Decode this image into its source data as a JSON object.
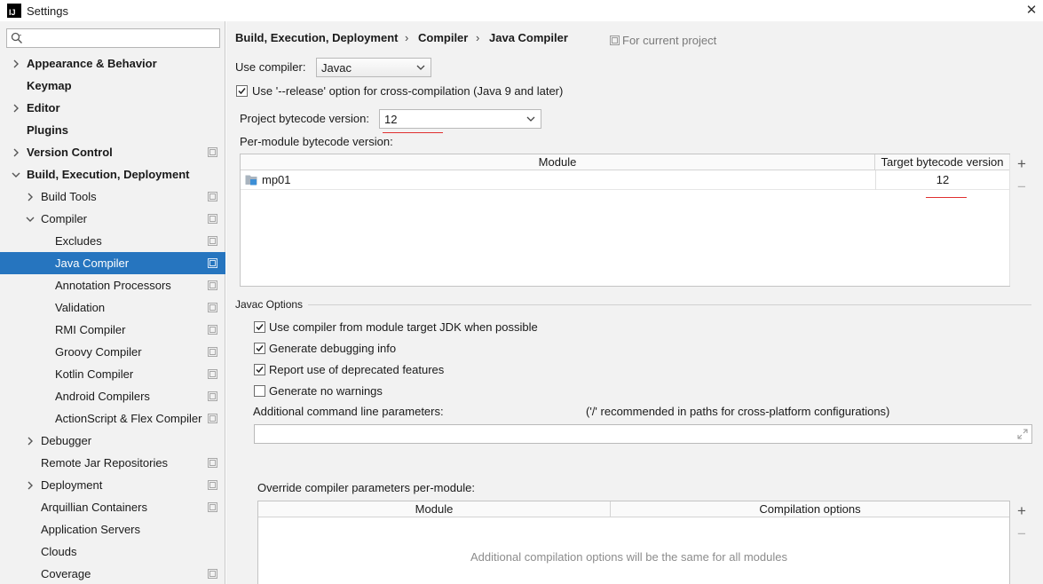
{
  "window": {
    "title": "Settings",
    "app_icon_text": "IJ"
  },
  "sidebar": {
    "search_placeholder": "",
    "items": [
      {
        "label": "Appearance & Behavior",
        "bold": true,
        "arrow": "right",
        "level": 0,
        "project": false
      },
      {
        "label": "Keymap",
        "bold": true,
        "arrow": "",
        "level": 0,
        "project": false
      },
      {
        "label": "Editor",
        "bold": true,
        "arrow": "right",
        "level": 0,
        "project": false
      },
      {
        "label": "Plugins",
        "bold": true,
        "arrow": "",
        "level": 0,
        "project": false
      },
      {
        "label": "Version Control",
        "bold": true,
        "arrow": "right",
        "level": 0,
        "project": true
      },
      {
        "label": "Build, Execution, Deployment",
        "bold": true,
        "arrow": "down",
        "level": 0,
        "project": false
      },
      {
        "label": "Build Tools",
        "bold": false,
        "arrow": "right",
        "level": 1,
        "project": true
      },
      {
        "label": "Compiler",
        "bold": false,
        "arrow": "down",
        "level": 1,
        "project": true
      },
      {
        "label": "Excludes",
        "bold": false,
        "arrow": "",
        "level": 2,
        "project": true
      },
      {
        "label": "Java Compiler",
        "bold": false,
        "arrow": "",
        "level": 2,
        "project": true,
        "selected": true
      },
      {
        "label": "Annotation Processors",
        "bold": false,
        "arrow": "",
        "level": 2,
        "project": true
      },
      {
        "label": "Validation",
        "bold": false,
        "arrow": "",
        "level": 2,
        "project": true
      },
      {
        "label": "RMI Compiler",
        "bold": false,
        "arrow": "",
        "level": 2,
        "project": true
      },
      {
        "label": "Groovy Compiler",
        "bold": false,
        "arrow": "",
        "level": 2,
        "project": true
      },
      {
        "label": "Kotlin Compiler",
        "bold": false,
        "arrow": "",
        "level": 2,
        "project": true
      },
      {
        "label": "Android Compilers",
        "bold": false,
        "arrow": "",
        "level": 2,
        "project": true
      },
      {
        "label": "ActionScript & Flex Compiler",
        "bold": false,
        "arrow": "",
        "level": 2,
        "project": true
      },
      {
        "label": "Debugger",
        "bold": false,
        "arrow": "right",
        "level": 1,
        "project": false
      },
      {
        "label": "Remote Jar Repositories",
        "bold": false,
        "arrow": "",
        "level": 1,
        "project": true
      },
      {
        "label": "Deployment",
        "bold": false,
        "arrow": "right",
        "level": 1,
        "project": true
      },
      {
        "label": "Arquillian Containers",
        "bold": false,
        "arrow": "",
        "level": 1,
        "project": true
      },
      {
        "label": "Application Servers",
        "bold": false,
        "arrow": "",
        "level": 1,
        "project": false
      },
      {
        "label": "Clouds",
        "bold": false,
        "arrow": "",
        "level": 1,
        "project": false
      },
      {
        "label": "Coverage",
        "bold": false,
        "arrow": "",
        "level": 1,
        "project": true
      }
    ]
  },
  "breadcrumb": {
    "parts": [
      "Build, Execution, Deployment",
      "Compiler",
      "Java Compiler"
    ],
    "separator": "›",
    "scope_note": "For current project"
  },
  "compiler": {
    "use_compiler_label": "Use compiler:",
    "use_compiler_value": "Javac",
    "release_option_label": "Use '--release' option for cross-compilation (Java 9 and later)",
    "release_option_checked": true,
    "project_bytecode_label": "Project bytecode version:",
    "project_bytecode_value": "12",
    "per_module_label": "Per-module bytecode version:",
    "module_table": {
      "headers": [
        "Module",
        "Target bytecode version"
      ],
      "rows": [
        {
          "module": "mp01",
          "target": "12"
        }
      ]
    }
  },
  "javac_options": {
    "title": "Javac Options",
    "checkboxes": [
      {
        "label": "Use compiler from module target JDK when possible",
        "checked": true
      },
      {
        "label": "Generate debugging info",
        "checked": true
      },
      {
        "label": "Report use of deprecated features",
        "checked": true
      },
      {
        "label": "Generate no warnings",
        "checked": false
      }
    ],
    "additional_params_label": "Additional command line parameters:",
    "additional_params_hint": "('/' recommended in paths for cross-platform configurations)",
    "additional_params_value": "",
    "override_label": "Override compiler parameters per-module:",
    "override_table": {
      "headers": [
        "Module",
        "Compilation options"
      ],
      "empty_text": "Additional compilation options will be the same for all modules"
    }
  },
  "tools": {
    "add": "+",
    "remove": "−"
  },
  "colors": {
    "selection": "#2675bf",
    "annotation_red": "#e03030",
    "panel_bg": "#f2f2f2"
  }
}
